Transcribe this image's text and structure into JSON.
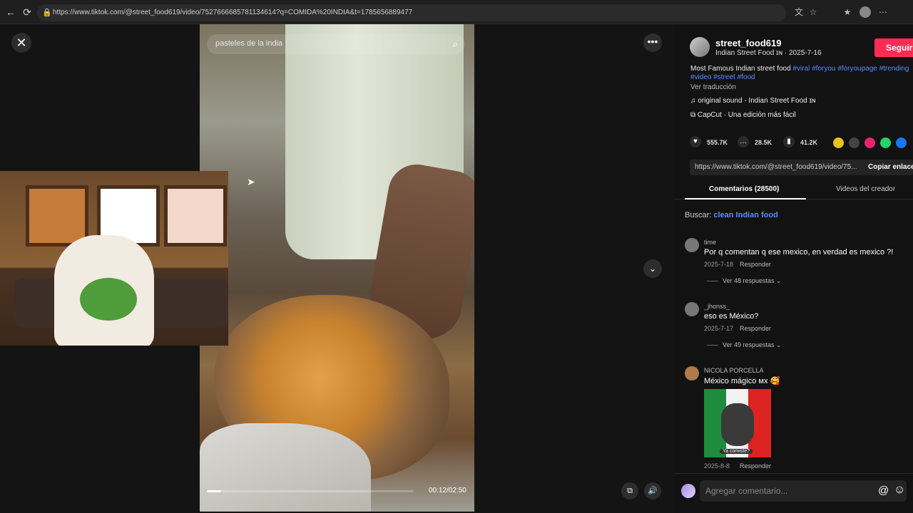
{
  "browser": {
    "url": "https://www.tiktok.com/@street_food619/video/7527666685781134614?q=COMIDA%20INDIA&t=1785656889477",
    "back_icon": "←",
    "reload_icon": "⟳",
    "lock_icon": "🔒",
    "translate_icon": "文",
    "star_icon": "☆",
    "bookmarks_icon": "★",
    "menu_icon": "⋯"
  },
  "video": {
    "close_icon": "✕",
    "search_text": "pasteles de la india",
    "search_icon": "⌕",
    "more_icon": "•••",
    "down_icon": "⌄",
    "timecode": "00:12/02:50",
    "progress": 0.07,
    "pip_icon": "⧉",
    "volume_icon": "🔊"
  },
  "creator": {
    "name": "street_food619",
    "subtitle": "Indian Street Food ɪɴ · 2025-7-16",
    "follow_label": "Seguir"
  },
  "description": {
    "text": "Most Famous Indian street food ",
    "tags": "#viral #foryou #foryoupage #trending #video #street #food",
    "translate": "Ver traducción",
    "sound": "♫  original sound - Indian Street Food ɪɴ",
    "capcut": "⧉  CapCut · Una edición más fácil"
  },
  "stats": {
    "likes": "555.7K",
    "comments": "28.5K",
    "saves": "41.2K",
    "like_icon": "♥",
    "comment_icon": "…",
    "save_icon": "▮"
  },
  "share": {
    "link": "https://www.tiktok.com/@street_food619/video/75...",
    "copy_label": "Copiar enlace"
  },
  "tabs": {
    "comments": "Comentarios (28500)",
    "creator_videos": "Videos del creador"
  },
  "search_suggestion": {
    "label": "Buscar: ",
    "query": "clean Indian food"
  },
  "comments": [
    {
      "user": "time",
      "text": "Por q comentan q ese mexico, en verdad es mexico ?!",
      "date": "2025-7-18",
      "reply": "Responder",
      "more": "Ver 48 respuestas ⌄"
    },
    {
      "user": "_jhonss_",
      "text": "eso es México?",
      "date": "2025-7-17",
      "reply": "Responder",
      "more": "Ver 49 respuestas ⌄"
    },
    {
      "user": "NICOLA PORCELLA",
      "text": "México mágico ᴍx 🥰",
      "date": "2025-8-8",
      "reply": "Responder",
      "gif_caption": "Ya comiste?"
    }
  ],
  "comment_box": {
    "placeholder": "Agregar comentario...",
    "at_icon": "@",
    "emoji_icon": "☺"
  }
}
